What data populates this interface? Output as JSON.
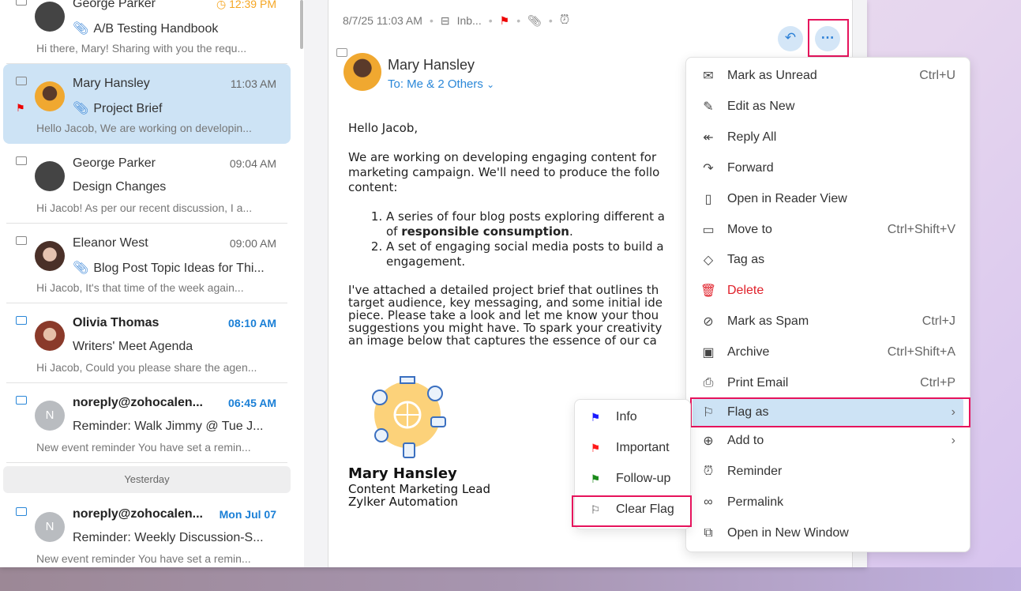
{
  "mail_list": [
    {
      "from": "George Parker",
      "time": "12:39 PM",
      "subject": "A/B Testing Handbook",
      "preview": "Hi there, Mary! Sharing with you the requ...",
      "attachment": true,
      "time_style": "reminder"
    },
    {
      "from": "Mary Hansley",
      "time": "11:03 AM",
      "subject": "Project Brief",
      "preview": "Hello Jacob, We are working on developin...",
      "attachment": true,
      "flag": "important",
      "selected": true
    },
    {
      "from": "George Parker",
      "time": "09:04 AM",
      "subject": "Design Changes",
      "preview": "Hi Jacob! As per our recent discussion, I a..."
    },
    {
      "from": "Eleanor West",
      "time": "09:00 AM",
      "subject": "Blog Post Topic Ideas for Thi...",
      "preview": "Hi Jacob, It's that time of the week again...",
      "attachment": true
    },
    {
      "from": "Olivia Thomas",
      "time": "08:10 AM",
      "subject": "Writers' Meet Agenda",
      "preview": "Hi Jacob, Could you please share the agen...",
      "unread": true
    },
    {
      "from": "noreply@zohocalen...",
      "time": "06:45 AM",
      "subject": "Reminder: Walk Jimmy @ Tue J...",
      "preview": "New event reminder You have set a remin...",
      "unread": true,
      "avatar": "N"
    }
  ],
  "group_label": "Yesterday",
  "mail_list_older": [
    {
      "from": "noreply@zohocalen...",
      "time": "Mon Jul 07",
      "subject": "Reminder: Weekly Discussion-S...",
      "preview": "New event reminder You have set a remin...",
      "unread": true,
      "avatar": "N"
    }
  ],
  "reader": {
    "datetime": "8/7/25 11:03 AM",
    "folder": "Inb...",
    "sender": "Mary Hansley",
    "to": "To: Me & 2 Others",
    "greeting": "Hello Jacob,",
    "para1_l1": "We are working on developing engaging content for",
    "para1_l2": "marketing campaign. We'll need to produce the follo",
    "para1_l3": "content:",
    "li1_l1": "A series of four blog posts exploring different a",
    "li1_l2a": "of ",
    "li1_bold": "responsible consumption",
    "li1_l2b": ".",
    "li2_l1": "A set of engaging social media posts to build a",
    "li2_l2": "engagement.",
    "para2": [
      "I've attached a detailed project brief that outlines th",
      "target audience, key messaging, and some initial ide",
      "piece. Please take a look and let me know your thou",
      "suggestions you might have. To spark your creativity",
      "an image below that captures the essence of our ca"
    ],
    "sig_name": "Mary Hansley",
    "sig_title": "Content Marketing Lead",
    "sig_company": "Zylker Automation"
  },
  "menu": [
    {
      "label": "Mark as Unread",
      "shortcut": "Ctrl+U",
      "icon": "envelope-icon"
    },
    {
      "label": "Edit as New",
      "shortcut": "",
      "icon": "pencil-icon"
    },
    {
      "label": "Reply All",
      "shortcut": "",
      "icon": "reply-all-icon"
    },
    {
      "label": "Forward",
      "shortcut": "",
      "icon": "forward-icon"
    },
    {
      "label": "Open in Reader View",
      "shortcut": "",
      "icon": "book-icon"
    },
    {
      "label": "Move to",
      "shortcut": "Ctrl+Shift+V",
      "icon": "folder-icon"
    },
    {
      "label": "Tag as",
      "shortcut": "",
      "icon": "tag-icon"
    },
    {
      "label": "Delete",
      "shortcut": "",
      "icon": "trash-icon"
    },
    {
      "label": "Mark as Spam",
      "shortcut": "Ctrl+J",
      "icon": "spam-icon"
    },
    {
      "label": "Archive",
      "shortcut": "Ctrl+Shift+A",
      "icon": "archive-icon"
    },
    {
      "label": "Print Email",
      "shortcut": "Ctrl+P",
      "icon": "printer-icon"
    },
    {
      "label": "Flag as",
      "shortcut": "",
      "icon": "flag-icon"
    },
    {
      "label": "Add to",
      "shortcut": "",
      "icon": "plus-circle-icon"
    },
    {
      "label": "Reminder",
      "shortcut": "",
      "icon": "alarm-icon"
    },
    {
      "label": "Permalink",
      "shortcut": "",
      "icon": "link-icon"
    },
    {
      "label": "Open in New Window",
      "shortcut": "",
      "icon": "external-icon"
    }
  ],
  "flag_submenu": [
    {
      "label": "Info",
      "color": "#1a1aff"
    },
    {
      "label": "Important",
      "color": "#ff1a1a"
    },
    {
      "label": "Follow-up",
      "color": "#1a8a1a"
    },
    {
      "label": "Clear Flag",
      "color": "#444444"
    }
  ],
  "colors": {
    "accent": "#2a87d8",
    "highlight": "#e6135c",
    "selected": "#cde3f5"
  }
}
